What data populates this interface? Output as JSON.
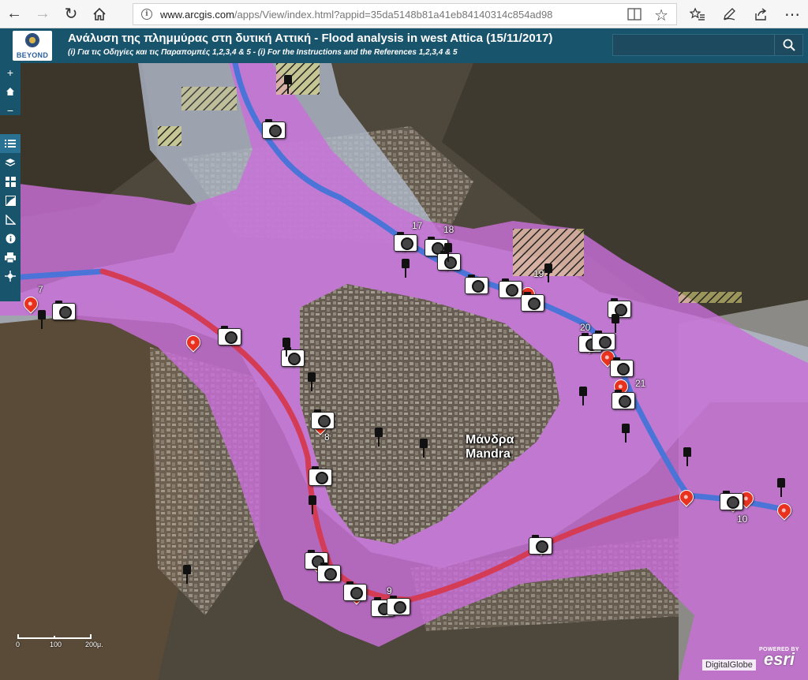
{
  "browser": {
    "url_host": "www.arcgis.com",
    "url_path": "/apps/View/index.html?appid=35da5148b81a41eb84140314c854ad98"
  },
  "app": {
    "logo_text": "BEYOND",
    "title": "Ανάλυση της πλημμύρας στη δυτική Αττική - Flood analysis in west Attica (15/11/2017)",
    "subtitle": "(i) Για τις Οδηγίες και τις Παραπομπές 1,2,3,4 & 5 - (i) For the Instructions and the References 1,2,3,4 & 5",
    "search_placeholder": ""
  },
  "map": {
    "place_label_greek": "Μάνδρα",
    "place_label_latin": "Mandra",
    "site_numbers": [
      "7",
      "8",
      "9",
      "10",
      "17",
      "18",
      "19",
      "20",
      "21"
    ],
    "scalebar": {
      "labels": [
        "0",
        "100",
        "200μ."
      ]
    },
    "attribution": "DigitalGlobe",
    "esri_powered": "POWERED BY",
    "esri_word": "esri"
  },
  "icons": {
    "browser": [
      "back-icon",
      "forward-icon",
      "refresh-icon",
      "home-icon",
      "info-icon",
      "reader-view-icon",
      "favorite-star-icon",
      "favorites-list-icon",
      "pen-icon",
      "share-icon",
      "more-icon"
    ],
    "toolbar": [
      "zoom-in-icon",
      "home-icon",
      "zoom-out-icon",
      "legend-list-icon",
      "layers-icon",
      "basemap-gallery-icon",
      "overview-map-icon",
      "measure-icon",
      "about-icon",
      "print-icon",
      "locate-icon"
    ],
    "map_markers": [
      "red-pin-icon",
      "camera-icon",
      "black-pushpin-icon"
    ]
  },
  "colors": {
    "header_bg": "#19546d",
    "flood_zone_magenta": "#c86fd8",
    "flood_zone_gray": "#b4bece",
    "stream_blue": "#4b74d8",
    "stream_red": "#d43c56",
    "marker_red": "#e8321f"
  }
}
